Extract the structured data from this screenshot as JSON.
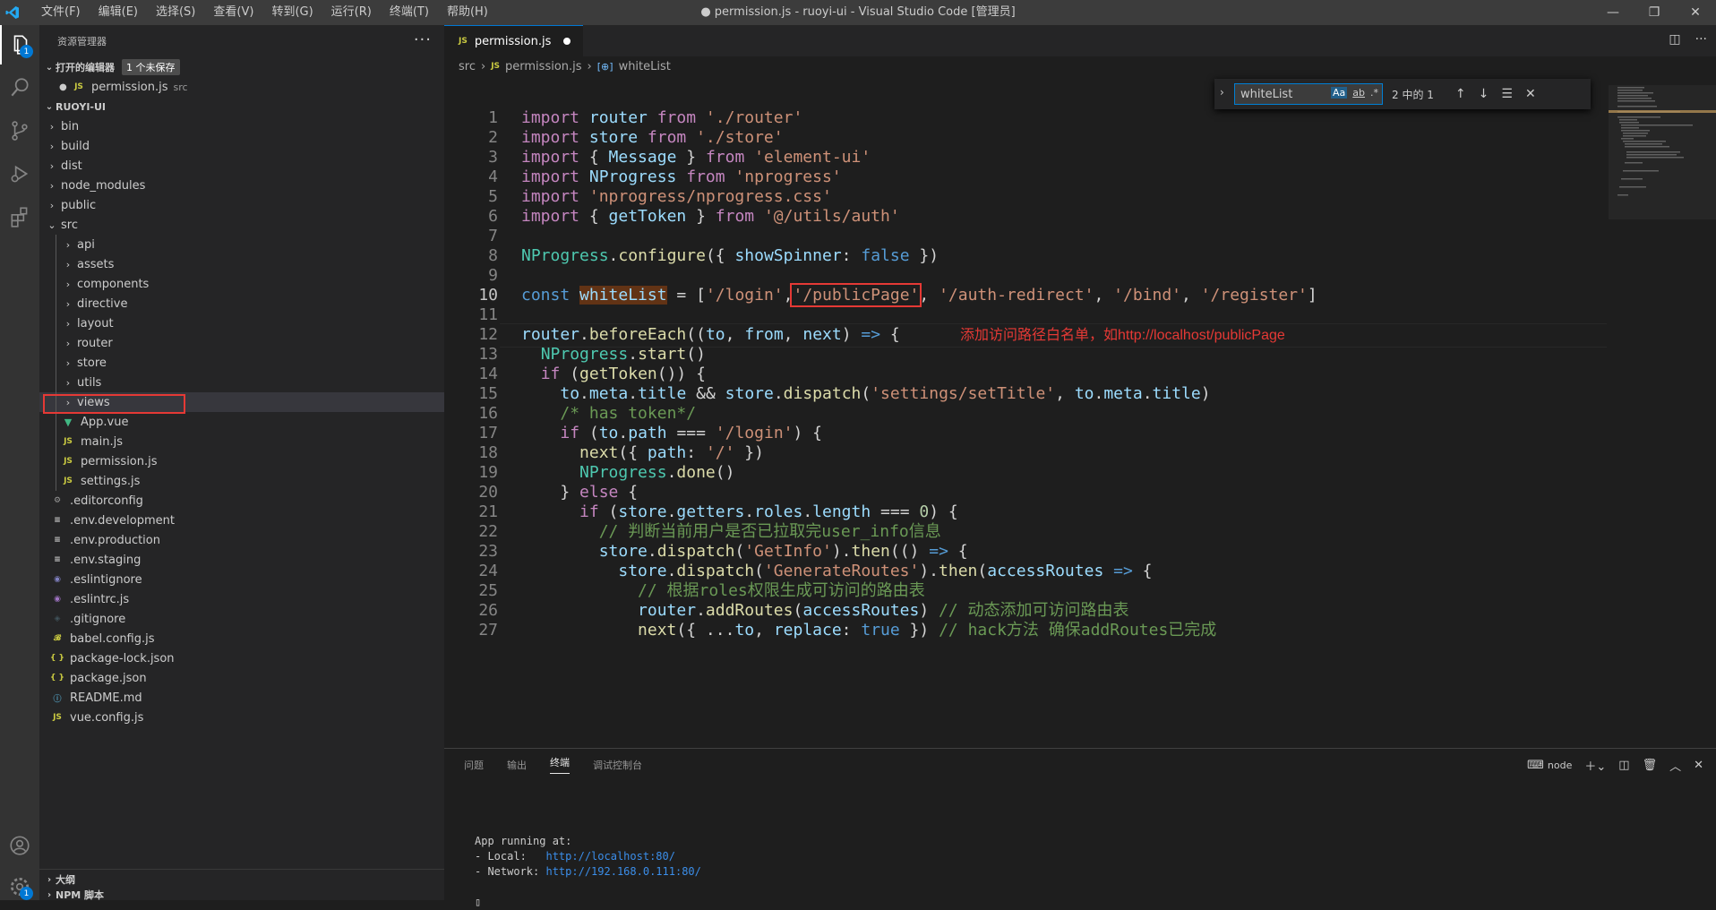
{
  "window": {
    "title": "● permission.js - ruoyi-ui - Visual Studio Code [管理员]",
    "menu": [
      "文件(F)",
      "编辑(E)",
      "选择(S)",
      "查看(V)",
      "转到(G)",
      "运行(R)",
      "终端(T)",
      "帮助(H)"
    ]
  },
  "activity": {
    "explorer_badge": "1",
    "settings_badge": "1"
  },
  "sidebar": {
    "title": "资源管理器",
    "open_editors": {
      "label": "打开的编辑器",
      "badge": "1 个未保存",
      "file": "permission.js",
      "file_dir": "src"
    },
    "project": "RUOYI-UI",
    "tree": [
      {
        "name": "bin",
        "type": "folder",
        "depth": 0
      },
      {
        "name": "build",
        "type": "folder",
        "depth": 0
      },
      {
        "name": "dist",
        "type": "folder",
        "depth": 0
      },
      {
        "name": "node_modules",
        "type": "folder",
        "depth": 0
      },
      {
        "name": "public",
        "type": "folder",
        "depth": 0
      },
      {
        "name": "src",
        "type": "folder-open",
        "depth": 0
      },
      {
        "name": "api",
        "type": "folder",
        "depth": 1
      },
      {
        "name": "assets",
        "type": "folder",
        "depth": 1
      },
      {
        "name": "components",
        "type": "folder",
        "depth": 1
      },
      {
        "name": "directive",
        "type": "folder",
        "depth": 1
      },
      {
        "name": "layout",
        "type": "folder",
        "depth": 1
      },
      {
        "name": "router",
        "type": "folder",
        "depth": 1
      },
      {
        "name": "store",
        "type": "folder",
        "depth": 1
      },
      {
        "name": "utils",
        "type": "folder",
        "depth": 1
      },
      {
        "name": "views",
        "type": "folder",
        "depth": 1
      },
      {
        "name": "App.vue",
        "type": "vue",
        "depth": 1
      },
      {
        "name": "main.js",
        "type": "js",
        "depth": 1
      },
      {
        "name": "permission.js",
        "type": "js",
        "depth": 1
      },
      {
        "name": "settings.js",
        "type": "js",
        "depth": 1
      },
      {
        "name": ".editorconfig",
        "type": "gear",
        "depth": 0
      },
      {
        "name": ".env.development",
        "type": "lines",
        "depth": 0
      },
      {
        "name": ".env.production",
        "type": "lines",
        "depth": 0
      },
      {
        "name": ".env.staging",
        "type": "lines",
        "depth": 0
      },
      {
        "name": ".eslintignore",
        "type": "eslint-dim",
        "depth": 0
      },
      {
        "name": ".eslintrc.js",
        "type": "eslint",
        "depth": 0
      },
      {
        "name": ".gitignore",
        "type": "git",
        "depth": 0
      },
      {
        "name": "babel.config.js",
        "type": "babel",
        "depth": 0
      },
      {
        "name": "package-lock.json",
        "type": "json",
        "depth": 0
      },
      {
        "name": "package.json",
        "type": "json",
        "depth": 0
      },
      {
        "name": "README.md",
        "type": "info",
        "depth": 0
      },
      {
        "name": "vue.config.js",
        "type": "js",
        "depth": 0
      }
    ],
    "outline": "大纲",
    "npm": "NPM 脚本"
  },
  "editor": {
    "tab": "permission.js",
    "breadcrumb": [
      "src",
      "permission.js",
      "whiteList"
    ],
    "annotation": "添加访问路径白名单，如http://localhost/publicPage",
    "find": {
      "query": "whiteList",
      "count": "2 中的 1",
      "opt_case": "Aa",
      "opt_word": "ab",
      "opt_regex": ".*"
    },
    "lines": [
      [
        [
          "import ",
          "c"
        ],
        [
          "router ",
          "v"
        ],
        [
          "from ",
          "c"
        ],
        [
          "'./router'",
          "s"
        ]
      ],
      [
        [
          "import ",
          "c"
        ],
        [
          "store ",
          "v"
        ],
        [
          "from ",
          "c"
        ],
        [
          "'./store'",
          "s"
        ]
      ],
      [
        [
          "import ",
          "c"
        ],
        [
          "{ ",
          "o"
        ],
        [
          "Message ",
          "v"
        ],
        [
          "} ",
          "o"
        ],
        [
          "from ",
          "c"
        ],
        [
          "'element-ui'",
          "s"
        ]
      ],
      [
        [
          "import ",
          "c"
        ],
        [
          "NProgress ",
          "v"
        ],
        [
          "from ",
          "c"
        ],
        [
          "'nprogress'",
          "s"
        ]
      ],
      [
        [
          "import ",
          "c"
        ],
        [
          "'nprogress/nprogress.css'",
          "s"
        ]
      ],
      [
        [
          "import ",
          "c"
        ],
        [
          "{ ",
          "o"
        ],
        [
          "getToken ",
          "v"
        ],
        [
          "} ",
          "o"
        ],
        [
          "from ",
          "c"
        ],
        [
          "'@/utils/auth'",
          "s"
        ]
      ],
      [],
      [
        [
          "NProgress",
          "ty"
        ],
        [
          ".",
          "o"
        ],
        [
          "configure",
          "f"
        ],
        [
          "({ ",
          "o"
        ],
        [
          "showSpinner",
          "v"
        ],
        [
          ": ",
          "o"
        ],
        [
          "false ",
          "k"
        ],
        [
          "})",
          "o"
        ]
      ],
      [],
      [
        [
          "const ",
          "k"
        ],
        [
          "whiteList",
          "v"
        ],
        [
          " = [",
          "o"
        ],
        [
          "'/login'",
          "s"
        ],
        [
          ",",
          "o"
        ],
        [
          "'/publicPage'",
          "s"
        ],
        [
          ", ",
          "o"
        ],
        [
          "'/auth-redirect'",
          "s"
        ],
        [
          ", ",
          "o"
        ],
        [
          "'/bind'",
          "s"
        ],
        [
          ", ",
          "o"
        ],
        [
          "'/register'",
          "s"
        ],
        [
          "]",
          "o"
        ]
      ],
      [],
      [
        [
          "router",
          "v"
        ],
        [
          ".",
          "o"
        ],
        [
          "beforeEach",
          "f"
        ],
        [
          "((",
          "o"
        ],
        [
          "to",
          "v"
        ],
        [
          ", ",
          "o"
        ],
        [
          "from",
          "v"
        ],
        [
          ", ",
          "o"
        ],
        [
          "next",
          "v"
        ],
        [
          ") ",
          "o"
        ],
        [
          "=> ",
          "k"
        ],
        [
          "{",
          "o"
        ]
      ],
      [
        [
          "  ",
          "o"
        ],
        [
          "NProgress",
          "ty"
        ],
        [
          ".",
          "o"
        ],
        [
          "start",
          "f"
        ],
        [
          "()",
          "o"
        ]
      ],
      [
        [
          "  ",
          "o"
        ],
        [
          "if ",
          "c"
        ],
        [
          "(",
          "o"
        ],
        [
          "getToken",
          "f"
        ],
        [
          "()) {",
          "o"
        ]
      ],
      [
        [
          "    ",
          "o"
        ],
        [
          "to",
          "v"
        ],
        [
          ".",
          "o"
        ],
        [
          "meta",
          "v"
        ],
        [
          ".",
          "o"
        ],
        [
          "title ",
          "v"
        ],
        [
          "&& ",
          "o"
        ],
        [
          "store",
          "v"
        ],
        [
          ".",
          "o"
        ],
        [
          "dispatch",
          "f"
        ],
        [
          "(",
          "o"
        ],
        [
          "'settings/setTitle'",
          "s"
        ],
        [
          ", ",
          "o"
        ],
        [
          "to",
          "v"
        ],
        [
          ".",
          "o"
        ],
        [
          "meta",
          "v"
        ],
        [
          ".",
          "o"
        ],
        [
          "title",
          "v"
        ],
        [
          ")",
          "o"
        ]
      ],
      [
        [
          "    ",
          "o"
        ],
        [
          "/* has token*/",
          "cm"
        ]
      ],
      [
        [
          "    ",
          "o"
        ],
        [
          "if ",
          "c"
        ],
        [
          "(",
          "o"
        ],
        [
          "to",
          "v"
        ],
        [
          ".",
          "o"
        ],
        [
          "path ",
          "v"
        ],
        [
          "=== ",
          "o"
        ],
        [
          "'/login'",
          "s"
        ],
        [
          ") {",
          "o"
        ]
      ],
      [
        [
          "      ",
          "o"
        ],
        [
          "next",
          "f"
        ],
        [
          "({ ",
          "o"
        ],
        [
          "path",
          "v"
        ],
        [
          ": ",
          "o"
        ],
        [
          "'/'",
          "s"
        ],
        [
          " })",
          "o"
        ]
      ],
      [
        [
          "      ",
          "o"
        ],
        [
          "NProgress",
          "ty"
        ],
        [
          ".",
          "o"
        ],
        [
          "done",
          "f"
        ],
        [
          "()",
          "o"
        ]
      ],
      [
        [
          "    ",
          "o"
        ],
        [
          "} ",
          "o"
        ],
        [
          "else ",
          "c"
        ],
        [
          "{",
          "o"
        ]
      ],
      [
        [
          "      ",
          "o"
        ],
        [
          "if ",
          "c"
        ],
        [
          "(",
          "o"
        ],
        [
          "store",
          "v"
        ],
        [
          ".",
          "o"
        ],
        [
          "getters",
          "v"
        ],
        [
          ".",
          "o"
        ],
        [
          "roles",
          "v"
        ],
        [
          ".",
          "o"
        ],
        [
          "length ",
          "v"
        ],
        [
          "=== ",
          "o"
        ],
        [
          "0",
          "n"
        ],
        [
          ") {",
          "o"
        ]
      ],
      [
        [
          "        ",
          "o"
        ],
        [
          "// 判断当前用户是否已拉取完user_info信息",
          "cm"
        ]
      ],
      [
        [
          "        ",
          "o"
        ],
        [
          "store",
          "v"
        ],
        [
          ".",
          "o"
        ],
        [
          "dispatch",
          "f"
        ],
        [
          "(",
          "o"
        ],
        [
          "'GetInfo'",
          "s"
        ],
        [
          ").",
          "o"
        ],
        [
          "then",
          "f"
        ],
        [
          "(() ",
          "o"
        ],
        [
          "=> ",
          "k"
        ],
        [
          "{",
          "o"
        ]
      ],
      [
        [
          "          ",
          "o"
        ],
        [
          "store",
          "v"
        ],
        [
          ".",
          "o"
        ],
        [
          "dispatch",
          "f"
        ],
        [
          "(",
          "o"
        ],
        [
          "'GenerateRoutes'",
          "s"
        ],
        [
          ").",
          "o"
        ],
        [
          "then",
          "f"
        ],
        [
          "(",
          "o"
        ],
        [
          "accessRoutes ",
          "v"
        ],
        [
          "=> ",
          "k"
        ],
        [
          "{",
          "o"
        ]
      ],
      [
        [
          "            ",
          "o"
        ],
        [
          "// 根据roles权限生成可访问的路由表",
          "cm"
        ]
      ],
      [
        [
          "            ",
          "o"
        ],
        [
          "router",
          "v"
        ],
        [
          ".",
          "o"
        ],
        [
          "addRoutes",
          "f"
        ],
        [
          "(",
          "o"
        ],
        [
          "accessRoutes",
          "v"
        ],
        [
          ") ",
          "o"
        ],
        [
          "// 动态添加可访问路由表",
          "cm"
        ]
      ],
      [
        [
          "            ",
          "o"
        ],
        [
          "next",
          "f"
        ],
        [
          "({ ",
          "o"
        ],
        [
          "...",
          "o"
        ],
        [
          "to",
          "v"
        ],
        [
          ", ",
          "o"
        ],
        [
          "replace",
          "v"
        ],
        [
          ": ",
          "o"
        ],
        [
          "true ",
          "k"
        ],
        [
          "}) ",
          "o"
        ],
        [
          "// hack方法 确保addRoutes已完成",
          "cm"
        ]
      ]
    ]
  },
  "panel": {
    "tabs": [
      "问题",
      "输出",
      "终端",
      "调试控制台"
    ],
    "active_tab": "终端",
    "terminal_name": "node",
    "terminal": {
      "heading": "App running at:",
      "local_label": "- Local:   ",
      "local_url": "http://localhost:80/",
      "network_label": "- Network: ",
      "network_url": "http://192.168.0.111:80/",
      "prompt": "▯"
    }
  }
}
